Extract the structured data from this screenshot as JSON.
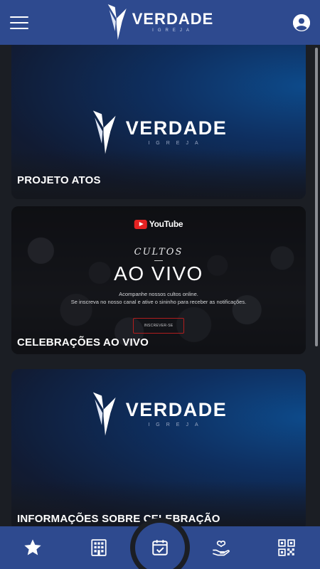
{
  "header": {
    "logo_text": "VERDADE",
    "logo_subtext": "IGREJA"
  },
  "cards": [
    {
      "title": "PROJETO ATOS",
      "logo_text": "VERDADE",
      "logo_subtext": "IGREJA"
    },
    {
      "title": "CELEBRAÇÕES AO VIVO",
      "brand": "YouTube",
      "kicker": "CULTOS",
      "headline": "AO VIVO",
      "desc_line1": "Acompanhe nossos cultos online.",
      "desc_line2": "Se inscreva no nosso canal e ative o sininho para receber as notificações.",
      "button_label": "INSCREVER-SE"
    },
    {
      "title": "INFORMAÇÕES SOBRE CELEBRAÇÃO",
      "logo_text": "VERDADE",
      "logo_subtext": "IGREJA"
    }
  ],
  "bottom_nav": {
    "items": [
      {
        "icon": "star-icon"
      },
      {
        "icon": "building-icon"
      },
      {
        "icon": "calendar-check-icon"
      },
      {
        "icon": "hand-heart-icon"
      },
      {
        "icon": "qr-code-icon"
      }
    ]
  },
  "colors": {
    "primary": "#2e4a8f",
    "background": "#1b1e24",
    "youtube_red": "#e52222"
  }
}
